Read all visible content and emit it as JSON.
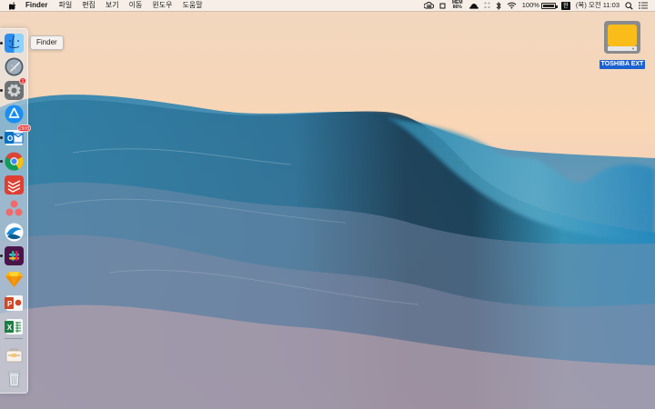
{
  "menubar": {
    "items": [
      "Finder",
      "파일",
      "편집",
      "보기",
      "이동",
      "윈도우",
      "도움말"
    ],
    "status": {
      "mem_top": "MEM",
      "mem_bottom": "86%",
      "battery_percent": "100%",
      "input_source": "한",
      "clock": "(목) 오전 11:03"
    }
  },
  "tooltip": {
    "label": "Finder"
  },
  "dock": {
    "badges": {
      "system_preferences": "1",
      "outlook": "2908"
    },
    "apps": [
      {
        "name": "Finder",
        "icon": "finder-icon"
      },
      {
        "name": "Launchpad",
        "icon": "rocket-icon"
      },
      {
        "name": "System Preferences",
        "icon": "gear-icon"
      },
      {
        "name": "App Store",
        "icon": "app-store-icon"
      },
      {
        "name": "Outlook",
        "icon": "mail-icon"
      },
      {
        "name": "Chrome",
        "icon": "chrome-icon"
      },
      {
        "name": "Todoist",
        "icon": "task-icon"
      },
      {
        "name": "Asana",
        "icon": "asana-icon"
      },
      {
        "name": "Mail app",
        "icon": "wave-icon"
      },
      {
        "name": "Slack",
        "icon": "slack-icon"
      },
      {
        "name": "Sketch",
        "icon": "diamond-icon"
      },
      {
        "name": "PowerPoint",
        "icon": "powerpoint-icon"
      },
      {
        "name": "Excel",
        "icon": "excel-icon"
      },
      {
        "name": "Briefcase",
        "icon": "briefcase-icon"
      },
      {
        "name": "Trash",
        "icon": "trash-icon"
      }
    ]
  },
  "desktop": {
    "drive_label": "TOSHIBA EXT"
  },
  "colors": {
    "drive_label_bg": "#1c61d2",
    "dock_bg": "rgba(226,233,242,0.50)",
    "wave_dark": "#1b6f97",
    "sky_warm": "#f7d8b8"
  }
}
